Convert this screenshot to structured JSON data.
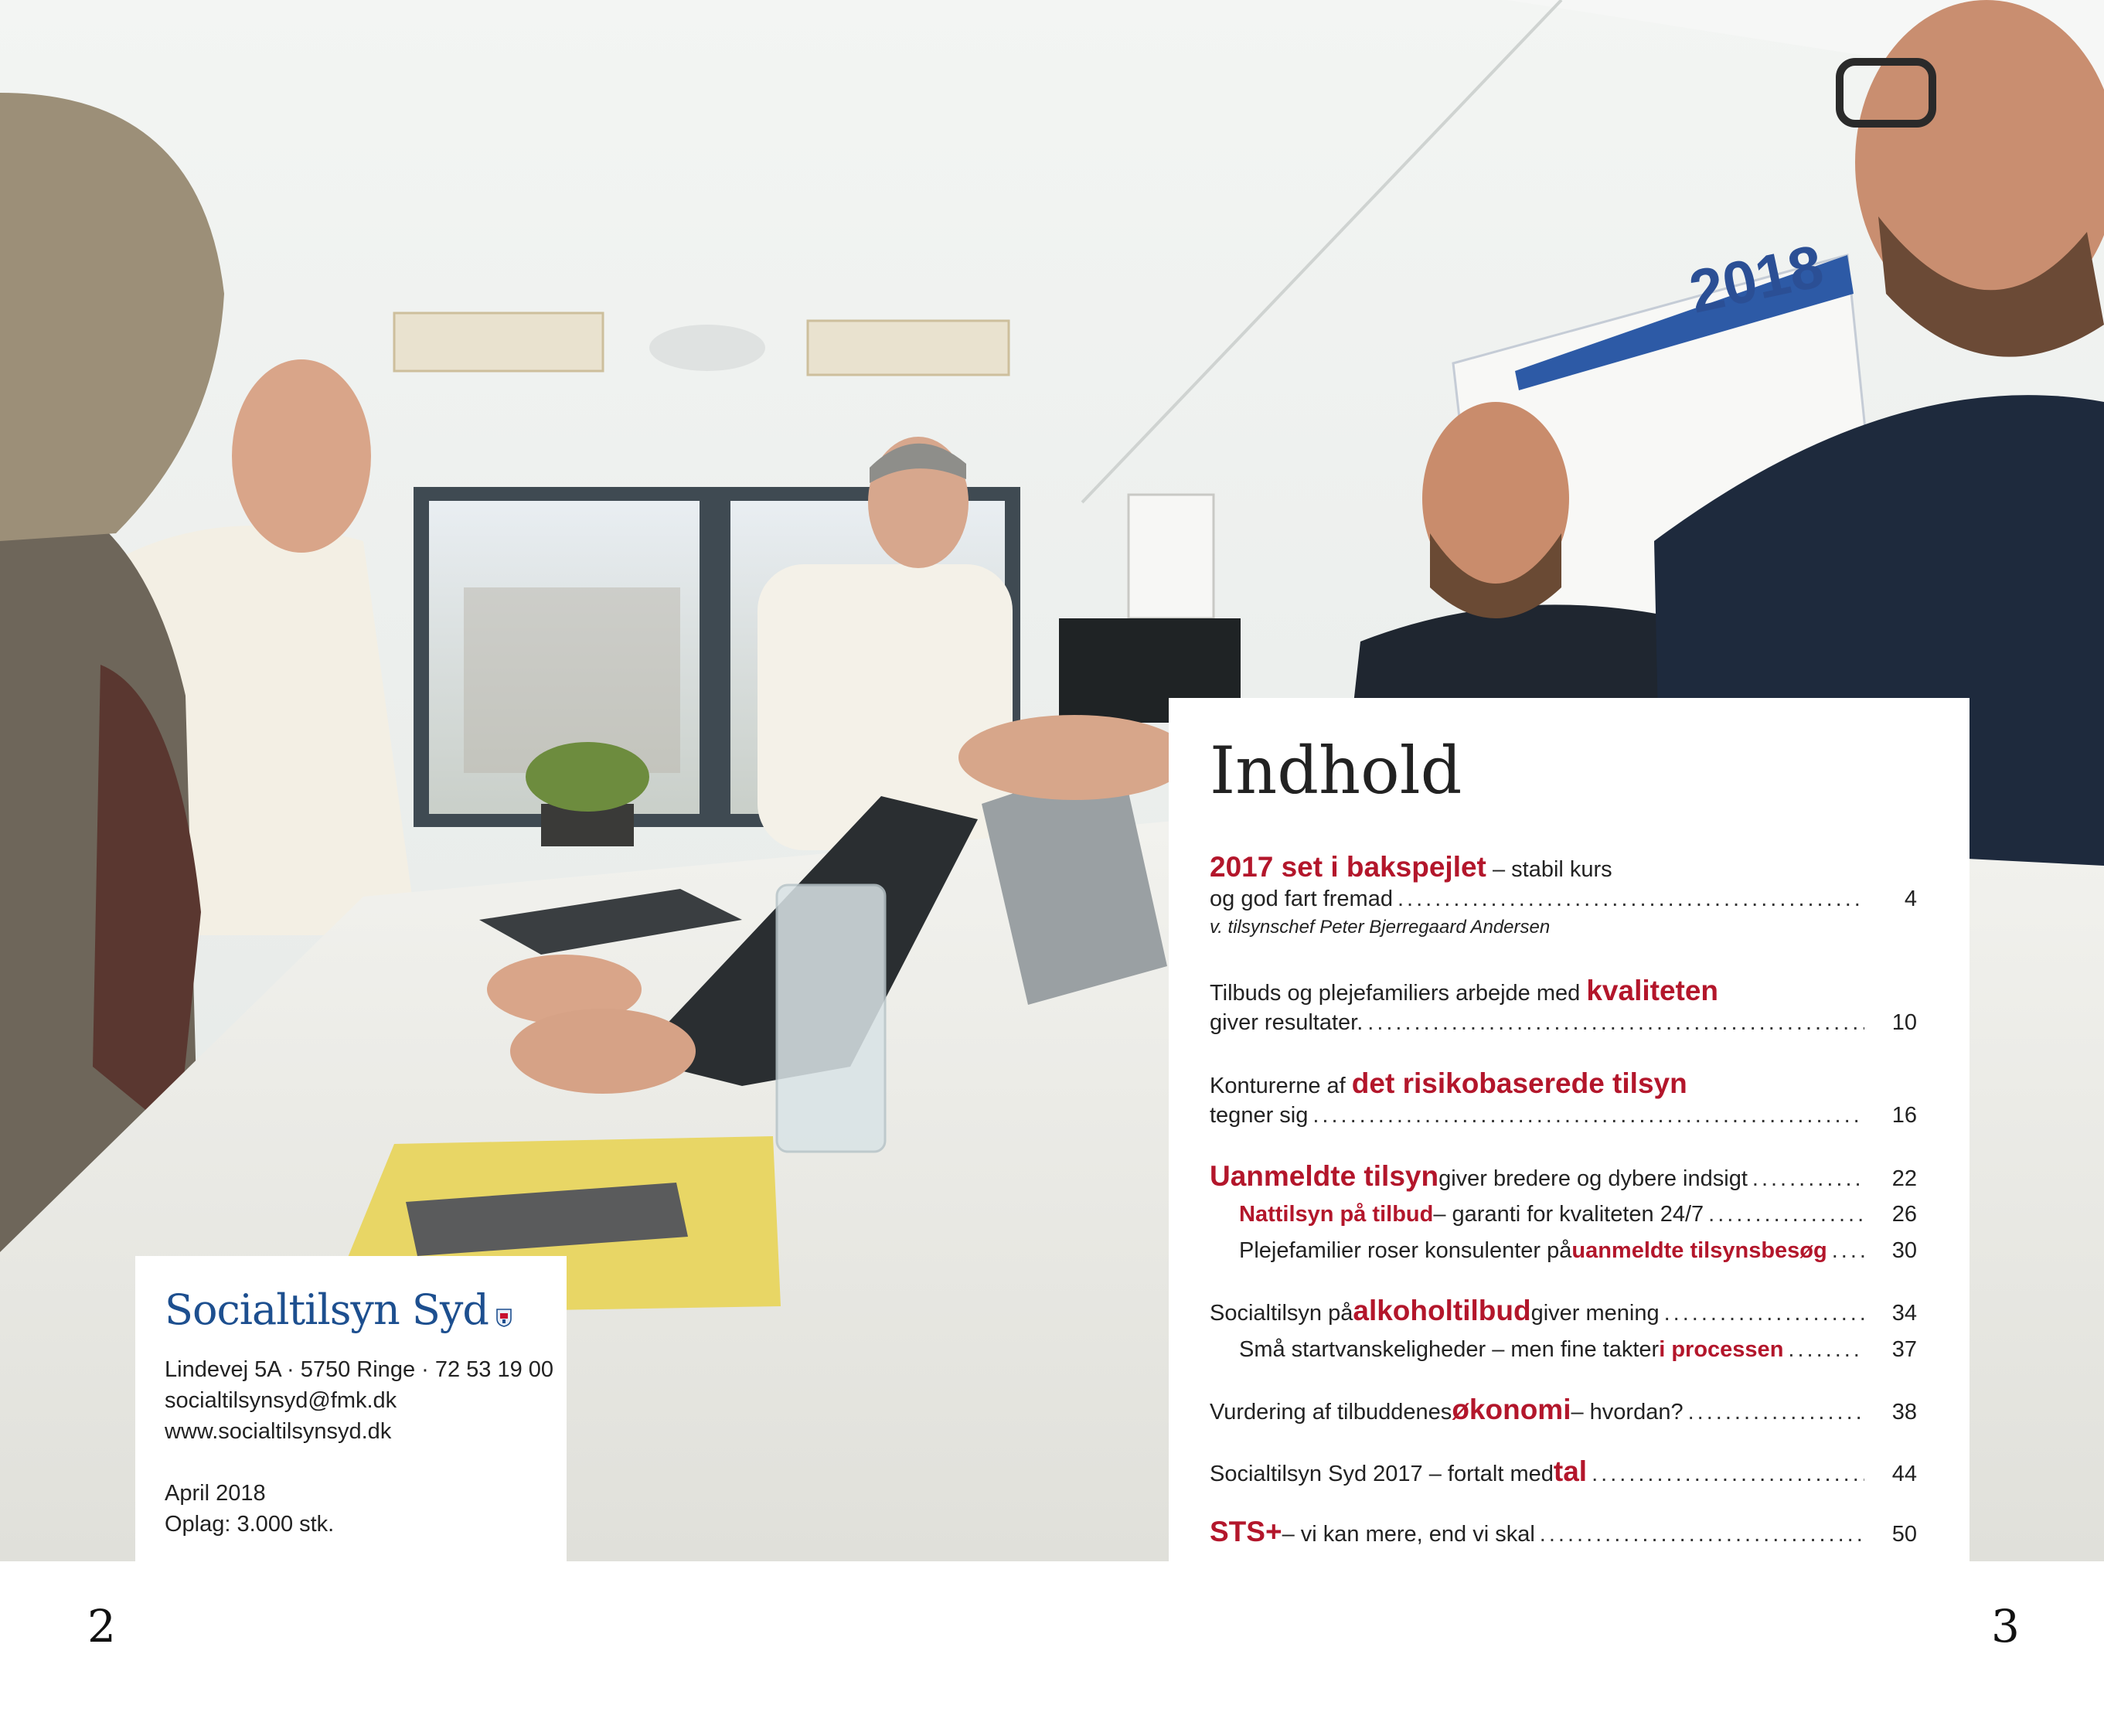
{
  "page": {
    "left_number": "2",
    "right_number": "3"
  },
  "photo": {
    "calendar_year": "2018"
  },
  "publisher": {
    "name": "Socialtilsyn Syd",
    "address": "Lindevej 5A · 5750 Ringe · 72 53 19 00",
    "email": "socialtilsynsyd@fmk.dk",
    "website": "www.socialtilsynsyd.dk",
    "date": "April 2018",
    "circulation": "Oplag: 3.000 stk."
  },
  "toc": {
    "title": "Indhold",
    "entries": [
      {
        "hl": "2017 set i bakspejlet",
        "after": " – stabil kurs",
        "line2": "og god fart fremad",
        "page": "4",
        "byline": "v. tilsynschef Peter Bjerregaard Andersen"
      },
      {
        "before": "Tilbuds og plejefamiliers arbejde med ",
        "hl": "kvaliteten",
        "line2": "giver resultater.",
        "page": "10"
      },
      {
        "before": "Konturerne af ",
        "hl": "det risikobaserede tilsyn",
        "line2": "tegner sig",
        "page": "16"
      },
      {
        "hl": "Uanmeldte tilsyn",
        "after": " giver bredere og dybere indsigt",
        "page": "22"
      },
      {
        "hl": "Nattilsyn på tilbud",
        "after": " – garanti for kvaliteten 24/7",
        "page": "26"
      },
      {
        "before": "Plejefamilier roser konsulenter på ",
        "hl": "uanmeldte tilsynsbesøg",
        "page": "30"
      },
      {
        "before": "Socialtilsyn på ",
        "hl": "alkoholtilbud",
        "after": " giver mening",
        "page": "34"
      },
      {
        "before": "Små startvanskeligheder – men fine takter ",
        "hl": "i processen",
        "page": "37"
      },
      {
        "before": "Vurdering af tilbuddenes ",
        "hl": "økonomi",
        "after": " – hvordan?",
        "page": "38"
      },
      {
        "before": "Socialtilsyn Syd 2017 – fortalt med ",
        "hl": "tal",
        "page": "44"
      },
      {
        "hl": "STS+",
        "after": " – vi kan mere, end vi skal",
        "page": "50"
      }
    ]
  },
  "colors": {
    "accent_red": "#b3162b",
    "brand_blue": "#1d4f8f"
  }
}
